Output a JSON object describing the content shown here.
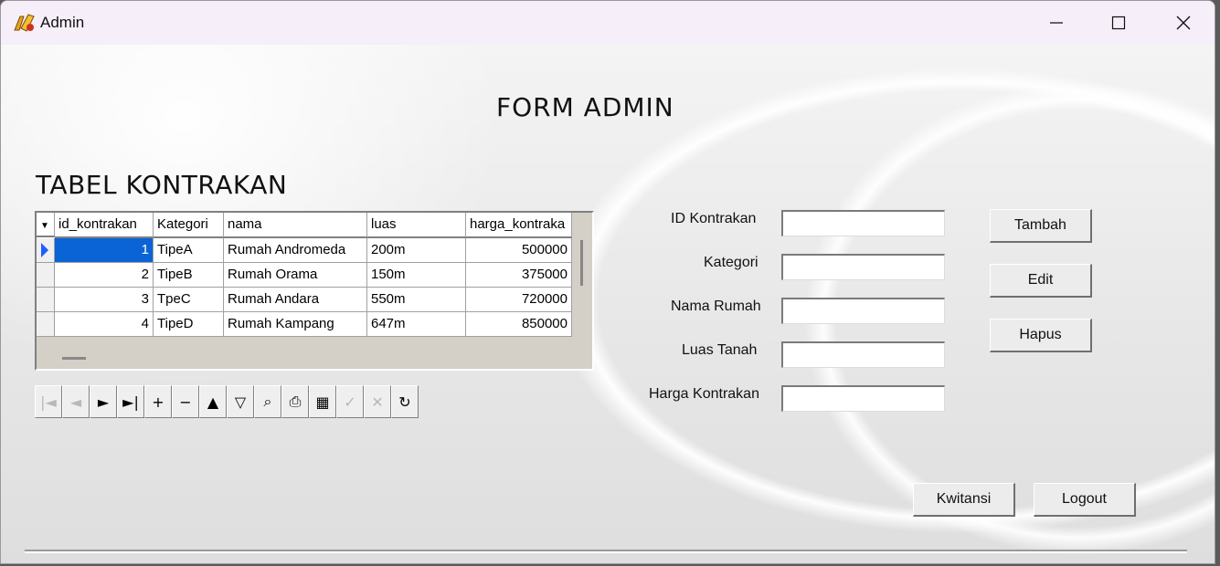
{
  "window": {
    "title": "Admin"
  },
  "form_title": "FORM ADMIN",
  "table_title": "TABEL KONTRAKAN",
  "grid": {
    "columns": [
      "id_kontrakan",
      "Kategori",
      "nama",
      "luas",
      "harga_kontraka"
    ],
    "rows": [
      [
        "1",
        "TipeA",
        "Rumah Andromeda",
        "200m",
        "500000"
      ],
      [
        "2",
        "TipeB",
        "Rumah Orama",
        "150m",
        "375000"
      ],
      [
        "3",
        "TpeC",
        "Rumah Andara",
        "550m",
        "720000"
      ],
      [
        "4",
        "TipeD",
        "Rumah Kampang",
        "647m",
        "850000"
      ]
    ],
    "selected_row": 0
  },
  "navigator": {
    "buttons": [
      {
        "icon": "first-record-icon",
        "glyph": "|◄",
        "enabled": false
      },
      {
        "icon": "prior-record-icon",
        "glyph": "◄",
        "enabled": false
      },
      {
        "icon": "next-record-icon",
        "glyph": "►",
        "enabled": true
      },
      {
        "icon": "last-record-icon",
        "glyph": "►|",
        "enabled": true
      },
      {
        "icon": "insert-record-icon",
        "glyph": "+",
        "enabled": true
      },
      {
        "icon": "delete-record-icon",
        "glyph": "−",
        "enabled": true
      },
      {
        "icon": "edit-record-icon",
        "glyph": "▲",
        "enabled": true
      },
      {
        "icon": "filter-icon",
        "glyph": "▽",
        "enabled": true
      },
      {
        "icon": "search-binoculars-icon",
        "glyph": "⌕",
        "enabled": true
      },
      {
        "icon": "print-icon",
        "glyph": "⎙",
        "enabled": true
      },
      {
        "icon": "grid-export-icon",
        "glyph": "▦",
        "enabled": true
      },
      {
        "icon": "post-record-icon",
        "glyph": "✓",
        "enabled": false
      },
      {
        "icon": "cancel-record-icon",
        "glyph": "✕",
        "enabled": false
      },
      {
        "icon": "refresh-icon",
        "glyph": "↻",
        "enabled": true
      }
    ]
  },
  "fields": {
    "id_label": "ID Kontrakan",
    "kategori_label": "Kategori",
    "nama_label": "Nama Rumah",
    "luas_label": "Luas Tanah",
    "harga_label": "Harga Kontrakan",
    "id_value": "",
    "kategori_value": "",
    "nama_value": "",
    "luas_value": "",
    "harga_value": ""
  },
  "buttons": {
    "tambah": "Tambah",
    "edit": "Edit",
    "hapus": "Hapus",
    "kwitansi": "Kwitansi",
    "logout": "Logout"
  },
  "colors": {
    "selection": "#0a64d6",
    "indicator": "#1f5fff"
  }
}
